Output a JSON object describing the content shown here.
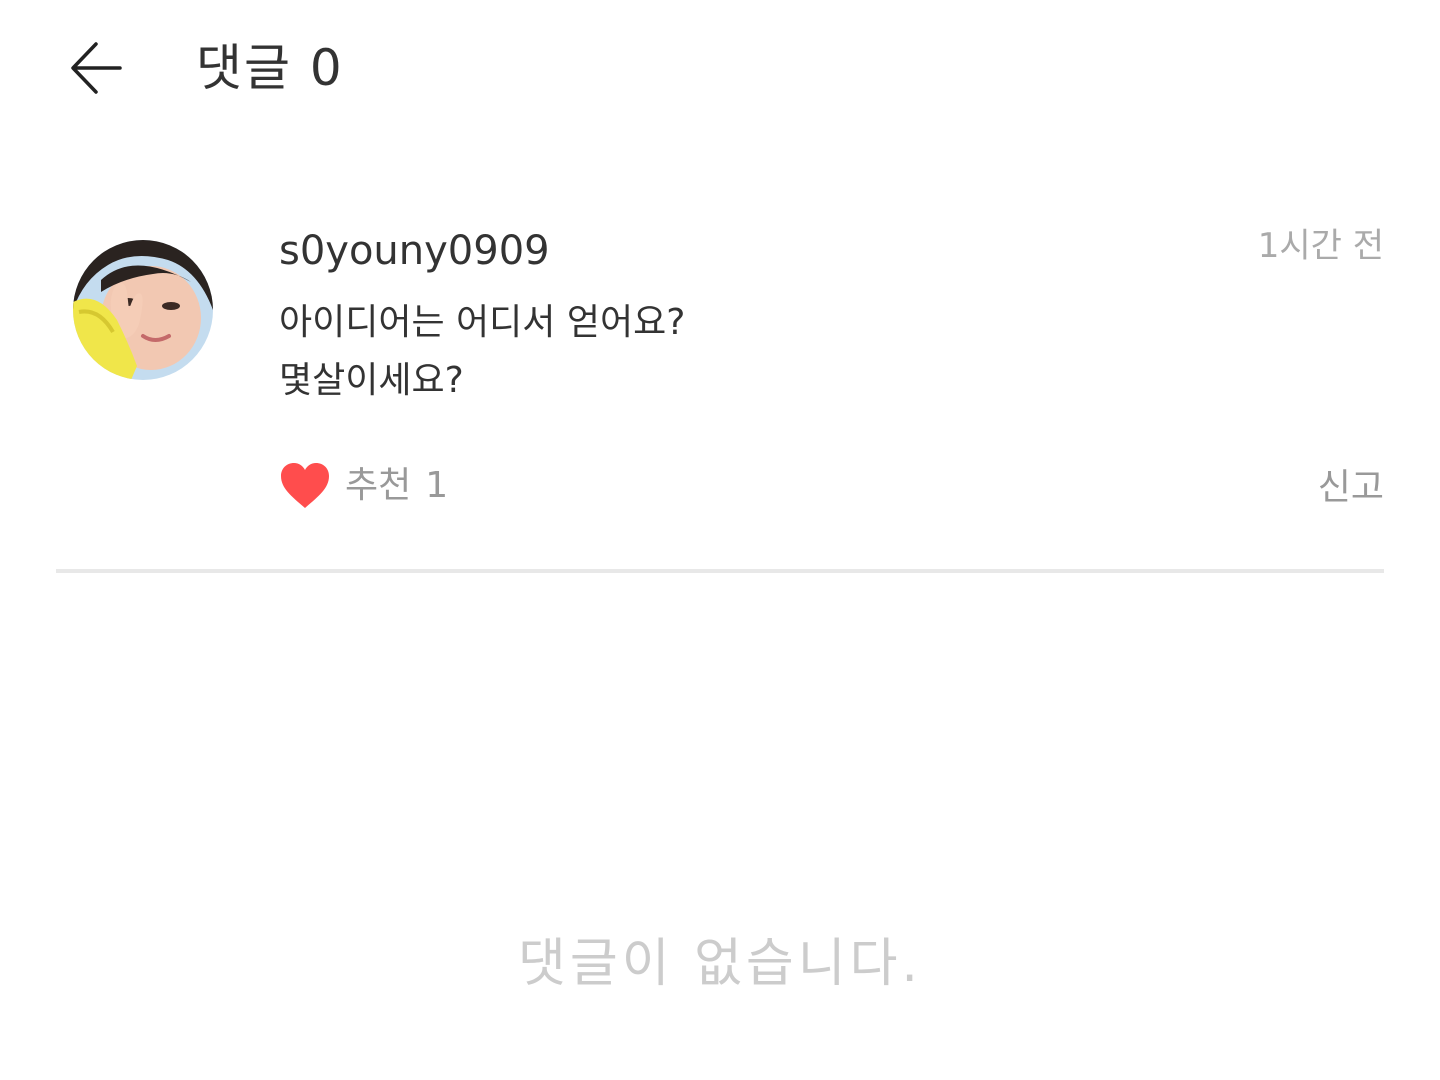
{
  "header": {
    "back_icon": "arrow-left-icon",
    "title": "댓글 0"
  },
  "comment": {
    "avatar_icon": "avatar",
    "username": "s0youny0909",
    "timestamp": "1시간 전",
    "body_lines": [
      "아이디어는 어디서 얻어요?",
      "몇살이세요?"
    ],
    "like": {
      "icon": "heart-icon",
      "label": "추천",
      "count": "1",
      "color": "#ff4d4d"
    },
    "report_label": "신고"
  },
  "empty_message": "댓글이 없습니다."
}
